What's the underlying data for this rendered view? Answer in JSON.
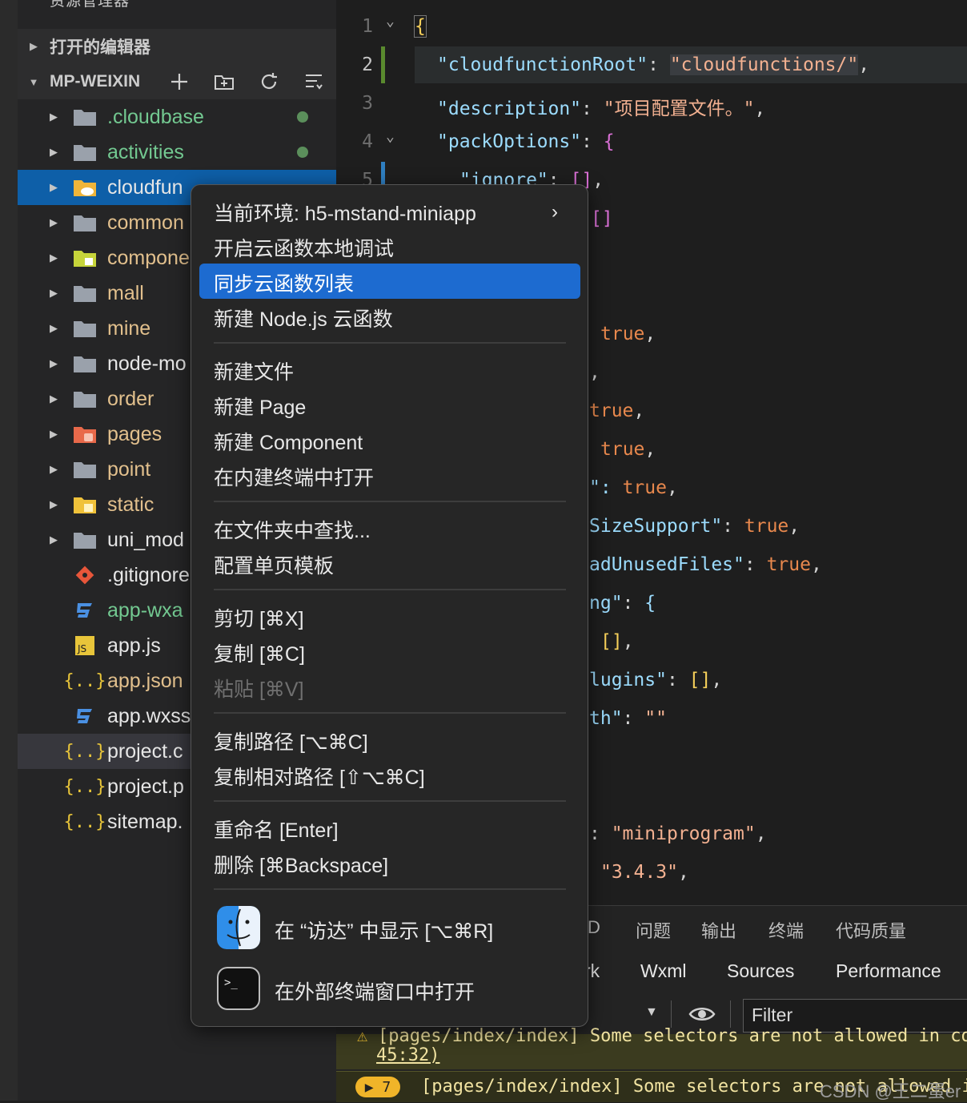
{
  "sidebar": {
    "title": "资源管理器",
    "more": "···",
    "section_open_editors": "打开的编辑器",
    "section_project": "MP-WEIXIN",
    "items": [
      {
        "label": ".cloudbase",
        "type": "folder",
        "color": "green",
        "dot": true
      },
      {
        "label": "activities",
        "type": "folder",
        "color": "green",
        "dot": true
      },
      {
        "label": "cloudfun",
        "type": "cloud-folder",
        "color": "white",
        "selected": true
      },
      {
        "label": "common",
        "type": "folder",
        "color": "yellow"
      },
      {
        "label": "compone",
        "type": "component-folder",
        "color": "yellow"
      },
      {
        "label": "mall",
        "type": "folder",
        "color": "yellow"
      },
      {
        "label": "mine",
        "type": "folder",
        "color": "yellow"
      },
      {
        "label": "node-mo",
        "type": "folder",
        "color": "white"
      },
      {
        "label": "order",
        "type": "folder",
        "color": "yellow"
      },
      {
        "label": "pages",
        "type": "pages-folder",
        "color": "yellow"
      },
      {
        "label": "point",
        "type": "folder",
        "color": "yellow"
      },
      {
        "label": "static",
        "type": "static-folder",
        "color": "yellow"
      },
      {
        "label": "uni_mod",
        "type": "folder",
        "color": "white"
      },
      {
        "label": ".gitignore",
        "type": "git-file",
        "color": "white"
      },
      {
        "label": "app-wxa",
        "type": "css-file",
        "color": "green"
      },
      {
        "label": "app.js",
        "type": "js-file",
        "color": "white"
      },
      {
        "label": "app.json",
        "type": "json-file",
        "color": "yellow"
      },
      {
        "label": "app.wxss",
        "type": "css-file",
        "color": "white"
      },
      {
        "label": "project.c",
        "type": "json-file",
        "color": "white",
        "hover": true
      },
      {
        "label": "project.p",
        "type": "json-file",
        "color": "white"
      },
      {
        "label": "sitemap.",
        "type": "json-file",
        "color": "white"
      }
    ]
  },
  "editor": {
    "line_numbers": [
      "1",
      "2",
      "3",
      "4",
      "5"
    ],
    "line1": "{",
    "line2_key": "\"cloudfunctionRoot\"",
    "line2_val": "\"cloudfunctions/\"",
    "line3_key": "\"description\"",
    "line3_val": "\"项目配置文件。\"",
    "line4_key": "\"packOptions\"",
    "line5_key": "\"ignore\"",
    "frag_brackets": "[]",
    "frag_true": "true",
    "frag_comma": ",",
    "frag_quote_colon": "\":",
    "frag_size": "SizeSupport\"",
    "frag_unused": "adUnusedFiles\"",
    "frag_ng": "ng\"",
    "frag_lugins": "lugins\"",
    "frag_th": "th\"",
    "frag_empty": "\"\"",
    "frag_miniprogram": "\"miniprogram\"",
    "frag_version": "\"3.4.3\""
  },
  "menu": {
    "env": "当前环境: h5-mstand-miniapp",
    "local_debug": "开启云函数本地调试",
    "sync_list": "同步云函数列表",
    "new_node": "新建 Node.js 云函数",
    "new_file": "新建文件",
    "new_page": "新建 Page",
    "new_component": "新建 Component",
    "open_terminal": "在内建终端中打开",
    "find_in_folder": "在文件夹中查找...",
    "page_template": "配置单页模板",
    "cut": "剪切 [⌘X]",
    "copy": "复制 [⌘C]",
    "paste": "粘贴 [⌘V]",
    "copy_path": "复制路径 [⌥⌘C]",
    "copy_rel_path": "复制相对路径 [⇧⌥⌘C]",
    "rename": "重命名 [Enter]",
    "delete": "删除 [⌘Backspace]",
    "reveal_finder": "在 “访达” 中显示 [⌥⌘R]",
    "open_external_terminal": "在外部终端窗口中打开"
  },
  "panel": {
    "tabs": [
      "问题",
      "输出",
      "终端",
      "代码质量"
    ],
    "tab_partial": "D",
    "devtools_tabs": [
      "rk",
      "Wxml",
      "Sources",
      "Performance"
    ],
    "filter_placeholder": "Filter",
    "console_line1": "[pages/index/index] Some selectors are not allowed in co",
    "console_line1b": "45:32)",
    "console_badge": "▶ 7",
    "console_line2": "[pages/index/index] Some selectors are not allowed i",
    "watermark": "CSDN @王二蛋er"
  }
}
